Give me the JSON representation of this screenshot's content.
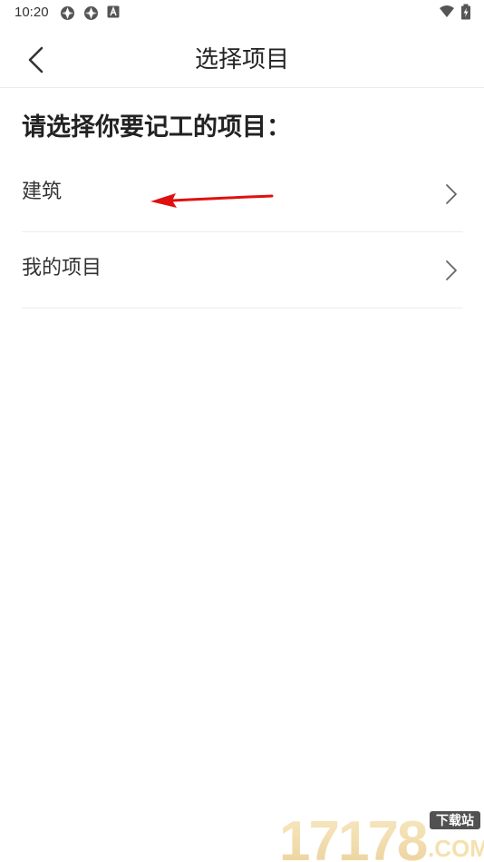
{
  "status_bar": {
    "time": "10:20"
  },
  "header": {
    "title": "选择项目"
  },
  "prompt": "请选择你要记工的项目：",
  "list_items": [
    {
      "label": "建筑"
    },
    {
      "label": "我的项目"
    }
  ],
  "watermark": {
    "brand": "17178",
    "badge": "下载站",
    "domain": ".COM"
  },
  "colors": {
    "annotation_arrow": "#e01010",
    "divider": "#ececec",
    "text": "#222222"
  }
}
